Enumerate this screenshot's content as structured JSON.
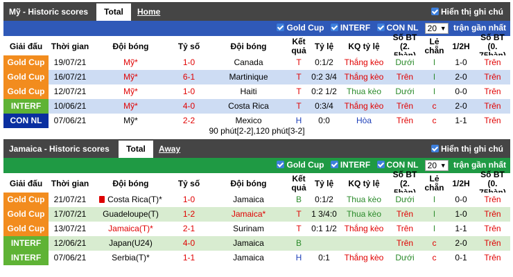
{
  "colors": {
    "goldcup": "#f28c1e",
    "interf": "#5fb335",
    "connl": "#0a2fa0",
    "us_bar": "#2f59b8",
    "jam_bar": "#1f9a44",
    "row_light": "#ffffff",
    "us_row_alt": "#cddcf3",
    "jam_row_alt": "#d8ecd0"
  },
  "panels": [
    {
      "title": "Mỹ - Historic scores",
      "tab_total": "Total",
      "tab_side": "Home",
      "show_notes": "Hiển thị ghi chú",
      "filters": [
        "Gold Cup",
        "INTERF",
        "CON NL"
      ],
      "count": "20",
      "recent_label": "trận gần nhất",
      "headers": [
        "Giải đấu",
        "Thời gian",
        "Đội bóng",
        "Tỷ số",
        "Đội bóng",
        "Kết quả",
        "Tỷ lệ",
        "KQ tỷ lệ",
        "Số BT (2. 5bàn)",
        "Lẻ chẵn",
        "1/2H",
        "Số BT (0. 75bàn)"
      ],
      "rows": [
        {
          "league": "Gold Cup",
          "league_key": "goldcup",
          "date": "19/07/21",
          "home": "Mỹ*",
          "home_red": true,
          "score": "1-0",
          "away": "Canada",
          "away_red": false,
          "result": "T",
          "odds": "0:1/2",
          "odds_result": "Thắng kèo",
          "ou25": "Dưới",
          "oddeven": "l",
          "half": "1-0",
          "ou075": "Trên"
        },
        {
          "league": "Gold Cup",
          "league_key": "goldcup",
          "date": "16/07/21",
          "home": "Mỹ*",
          "home_red": true,
          "score": "6-1",
          "away": "Martinique",
          "away_red": false,
          "result": "T",
          "odds": "0:2 3/4",
          "odds_result": "Thắng kèo",
          "ou25": "Trên",
          "oddeven": "l",
          "half": "2-0",
          "ou075": "Trên"
        },
        {
          "league": "Gold Cup",
          "league_key": "goldcup",
          "date": "12/07/21",
          "home": "Mỹ*",
          "home_red": true,
          "score": "1-0",
          "away": "Haiti",
          "away_red": false,
          "result": "T",
          "odds": "0:2 1/2",
          "odds_result": "Thua kèo",
          "ou25": "Dưới",
          "oddeven": "l",
          "half": "0-0",
          "ou075": "Trên"
        },
        {
          "league": "INTERF",
          "league_key": "interf",
          "date": "10/06/21",
          "home": "Mỹ*",
          "home_red": true,
          "score": "4-0",
          "away": "Costa Rica",
          "away_red": false,
          "result": "T",
          "odds": "0:3/4",
          "odds_result": "Thắng kèo",
          "ou25": "Trên",
          "oddeven": "c",
          "half": "2-0",
          "ou075": "Trên"
        },
        {
          "league": "CON NL",
          "league_key": "connl",
          "date": "07/06/21",
          "home": "Mỹ*",
          "home_red": false,
          "score": "2-2",
          "away": "Mexico",
          "away_red": false,
          "result": "H",
          "odds": "0:0",
          "odds_result": "Hòa",
          "ou25": "Trên",
          "oddeven": "c",
          "half": "1-1",
          "ou075": "Trên"
        }
      ],
      "note": "90 phút[2-2],120 phút[3-2]"
    },
    {
      "title": "Jamaica - Historic scores",
      "tab_total": "Total",
      "tab_side": "Away",
      "show_notes": "Hiển thị ghi chú",
      "filters": [
        "Gold Cup",
        "INTERF",
        "CON NL"
      ],
      "count": "20",
      "recent_label": "trận gần nhất",
      "headers": [
        "Giải đấu",
        "Thời gian",
        "Đội bóng",
        "Tỷ số",
        "Đội bóng",
        "Kết quả",
        "Tỷ lệ",
        "KQ tỷ lệ",
        "Số BT (2. 5bàn)",
        "Lẻ chẵn",
        "1/2H",
        "Số BT (0. 75bàn)"
      ],
      "rows": [
        {
          "league": "Gold Cup",
          "league_key": "goldcup",
          "date": "21/07/21",
          "home": "Costa Rica(T)*",
          "home_red": false,
          "home_flag": true,
          "score": "1-0",
          "away": "Jamaica",
          "away_red": false,
          "result": "B",
          "odds": "0:1/2",
          "odds_result": "Thua kèo",
          "ou25": "Dưới",
          "oddeven": "l",
          "half": "0-0",
          "ou075": "Trên"
        },
        {
          "league": "Gold Cup",
          "league_key": "goldcup",
          "date": "17/07/21",
          "home": "Guadeloupe(T)",
          "home_red": false,
          "score": "1-2",
          "away": "Jamaica*",
          "away_red": true,
          "result": "T",
          "odds": "1 3/4:0",
          "odds_result": "Thua kèo",
          "ou25": "Trên",
          "oddeven": "l",
          "half": "1-0",
          "ou075": "Trên"
        },
        {
          "league": "Gold Cup",
          "league_key": "goldcup",
          "date": "13/07/21",
          "home": "Jamaica(T)*",
          "home_red": true,
          "score": "2-1",
          "away": "Surinam",
          "away_red": false,
          "result": "T",
          "odds": "0:1 1/2",
          "odds_result": "Thắng kèo",
          "ou25": "Trên",
          "oddeven": "l",
          "half": "1-1",
          "ou075": "Trên"
        },
        {
          "league": "INTERF",
          "league_key": "interf",
          "date": "12/06/21",
          "home": "Japan(U24)",
          "home_red": false,
          "score": "4-0",
          "away": "Jamaica",
          "away_red": false,
          "result": "B",
          "odds": "",
          "odds_result": "",
          "ou25": "Trên",
          "oddeven": "c",
          "half": "2-0",
          "ou075": "Trên"
        },
        {
          "league": "INTERF",
          "league_key": "interf",
          "date": "07/06/21",
          "home": "Serbia(T)*",
          "home_red": false,
          "score": "1-1",
          "away": "Jamaica",
          "away_red": false,
          "result": "H",
          "odds": "0:1",
          "odds_result": "Thắng kèo",
          "ou25": "Dưới",
          "oddeven": "c",
          "half": "0-1",
          "ou075": "Trên"
        }
      ]
    }
  ]
}
